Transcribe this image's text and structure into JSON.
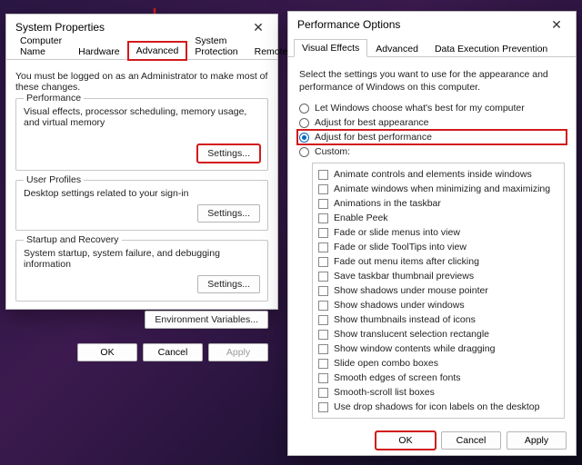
{
  "sp": {
    "title": "System Properties",
    "tabs": [
      "Computer Name",
      "Hardware",
      "Advanced",
      "System Protection",
      "Remote"
    ],
    "active_tab": 2,
    "admin_line": "You must be logged on as an Administrator to make most of these changes.",
    "perf": {
      "legend": "Performance",
      "desc": "Visual effects, processor scheduling, memory usage, and virtual memory",
      "btn": "Settings..."
    },
    "profiles": {
      "legend": "User Profiles",
      "desc": "Desktop settings related to your sign-in",
      "btn": "Settings..."
    },
    "startup": {
      "legend": "Startup and Recovery",
      "desc": "System startup, system failure, and debugging information",
      "btn": "Settings..."
    },
    "envvars": "Environment Variables...",
    "ok": "OK",
    "cancel": "Cancel",
    "apply": "Apply"
  },
  "po": {
    "title": "Performance Options",
    "tabs": [
      "Visual Effects",
      "Advanced",
      "Data Execution Prevention"
    ],
    "active_tab": 0,
    "intro": "Select the settings you want to use for the appearance and performance of Windows on this computer.",
    "radios": [
      "Let Windows choose what's best for my computer",
      "Adjust for best appearance",
      "Adjust for best performance",
      "Custom:"
    ],
    "selected_radio": 2,
    "checks": [
      "Animate controls and elements inside windows",
      "Animate windows when minimizing and maximizing",
      "Animations in the taskbar",
      "Enable Peek",
      "Fade or slide menus into view",
      "Fade or slide ToolTips into view",
      "Fade out menu items after clicking",
      "Save taskbar thumbnail previews",
      "Show shadows under mouse pointer",
      "Show shadows under windows",
      "Show thumbnails instead of icons",
      "Show translucent selection rectangle",
      "Show window contents while dragging",
      "Slide open combo boxes",
      "Smooth edges of screen fonts",
      "Smooth-scroll list boxes",
      "Use drop shadows for icon labels on the desktop"
    ],
    "ok": "OK",
    "cancel": "Cancel",
    "apply": "Apply"
  }
}
